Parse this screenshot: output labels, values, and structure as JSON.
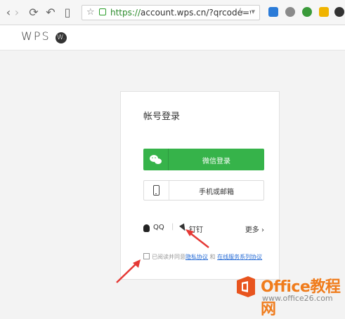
{
  "browser": {
    "address_https": "https://",
    "address_rest": "account.wps.cn/?qrcode=wxminic",
    "icons": [
      "back-icon",
      "forward-icon",
      "reload-icon",
      "history-icon",
      "reader-icon",
      "star-icon",
      "bolt-icon",
      "dropdown-icon"
    ]
  },
  "header": {
    "logo_text": "WPS",
    "logo_badge": "W."
  },
  "login": {
    "title": "帐号登录",
    "wechat_label": "微信登录",
    "phone_label": "手机或邮箱",
    "qq_label": "QQ",
    "separator": "|",
    "ding_label": "钉钉",
    "more_label": "更多",
    "agree_text": "已阅读并同意",
    "privacy_link": "隐私协议",
    "and_text": "和",
    "service_link": "在线服务系列协议"
  },
  "watermark": {
    "title": "Office教程网",
    "url": "www.office26.com"
  },
  "colors": {
    "wechat_green": "#36b34a",
    "link_blue": "#2a6ed6",
    "arrow_red": "#e53935",
    "watermark_orange": "#f07c1c"
  }
}
